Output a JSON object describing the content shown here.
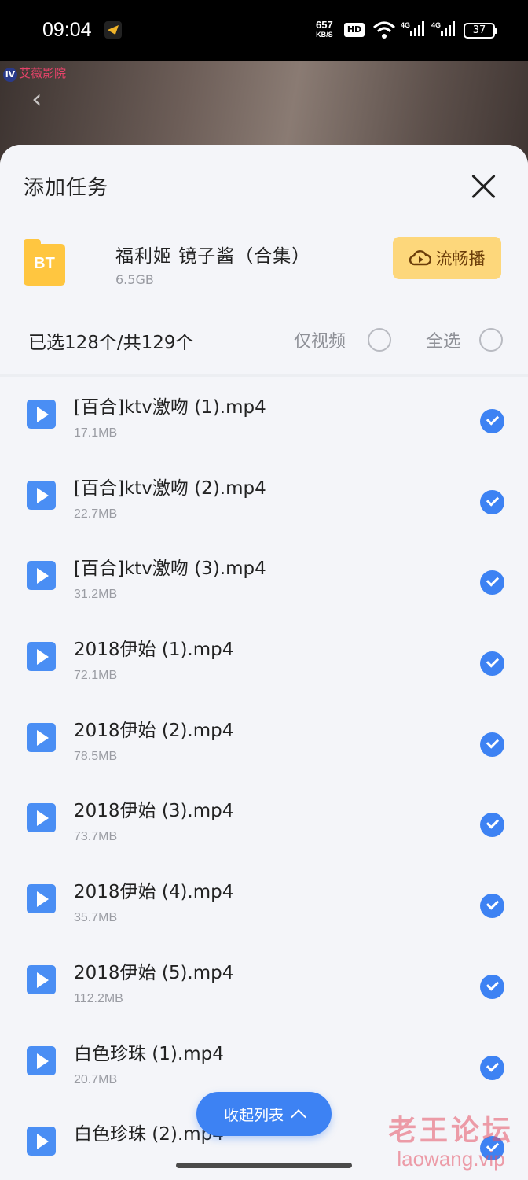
{
  "status_bar": {
    "time": "09:04",
    "net_speed": "657",
    "net_speed_unit": "KB/S",
    "hd_badge": "HD",
    "signal_1": "4G",
    "signal_2": "4G",
    "battery": "37"
  },
  "backdrop": {
    "site_logo_badge": "iV",
    "site_logo_text": "艾薇影院",
    "back_glyph": "‹"
  },
  "sheet": {
    "title": "添加任务",
    "task": {
      "icon_label": "BT",
      "name": "福利姬 镜子酱（合集）",
      "size": "6.5GB",
      "stream_button": "流畅播"
    },
    "selection": {
      "count_label": "已选128个/共129个",
      "video_only_label": "仅视频",
      "select_all_label": "全选"
    },
    "files": [
      {
        "name": "[百合]ktv激吻 (1).mp4",
        "size": "17.1MB",
        "checked": true
      },
      {
        "name": "[百合]ktv激吻 (2).mp4",
        "size": "22.7MB",
        "checked": true
      },
      {
        "name": "[百合]ktv激吻 (3).mp4",
        "size": "31.2MB",
        "checked": true
      },
      {
        "name": "2018伊始 (1).mp4",
        "size": "72.1MB",
        "checked": true
      },
      {
        "name": "2018伊始 (2).mp4",
        "size": "78.5MB",
        "checked": true
      },
      {
        "name": "2018伊始 (3).mp4",
        "size": "73.7MB",
        "checked": true
      },
      {
        "name": "2018伊始 (4).mp4",
        "size": "35.7MB",
        "checked": true
      },
      {
        "name": "2018伊始 (5).mp4",
        "size": "112.2MB",
        "checked": true
      },
      {
        "name": "白色珍珠 (1).mp4",
        "size": "20.7MB",
        "checked": true
      },
      {
        "name": "白色珍珠 (2).mp4",
        "size": "",
        "checked": true
      }
    ],
    "collapse_button": "收起列表"
  },
  "watermark": {
    "text": "老王论坛",
    "url": "laowang.vip"
  },
  "colors": {
    "accent_blue": "#3d82f3",
    "stream_button_bg": "#fdd77b",
    "bt_icon": "#ffc640",
    "sheet_bg": "#f4f5f9"
  }
}
